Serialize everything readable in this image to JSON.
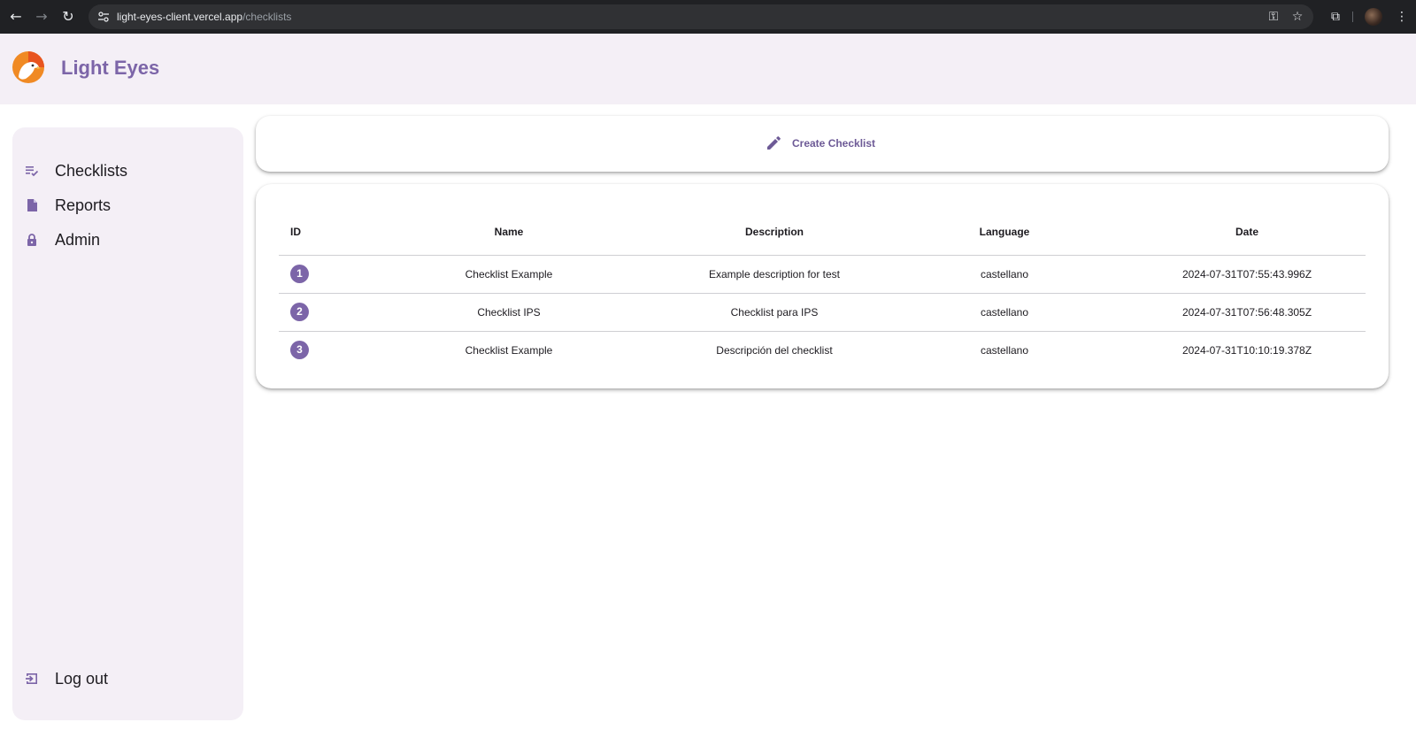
{
  "browser": {
    "url_host": "light-eyes-client.vercel.app",
    "url_path": "/checklists"
  },
  "app": {
    "title": "Light Eyes"
  },
  "sidebar": {
    "items": [
      {
        "label": "Checklists",
        "icon": "checklist-icon"
      },
      {
        "label": "Reports",
        "icon": "document-icon"
      },
      {
        "label": "Admin",
        "icon": "lock-icon"
      }
    ],
    "logout_label": "Log out"
  },
  "toolbar": {
    "create_label": "Create Checklist"
  },
  "table": {
    "headers": {
      "id": "ID",
      "name": "Name",
      "description": "Description",
      "language": "Language",
      "date": "Date"
    },
    "rows": [
      {
        "id": "1",
        "name": "Checklist Example",
        "description": "Example description for test",
        "language": "castellano",
        "date": "2024-07-31T07:55:43.996Z"
      },
      {
        "id": "2",
        "name": "Checklist IPS",
        "description": "Checklist para IPS",
        "language": "castellano",
        "date": "2024-07-31T07:56:48.305Z"
      },
      {
        "id": "3",
        "name": "Checklist Example",
        "description": "Descripción del checklist",
        "language": "castellano",
        "date": "2024-07-31T10:10:19.378Z"
      }
    ]
  },
  "colors": {
    "accent": "#7c65a8",
    "surface": "#f4eff6"
  }
}
